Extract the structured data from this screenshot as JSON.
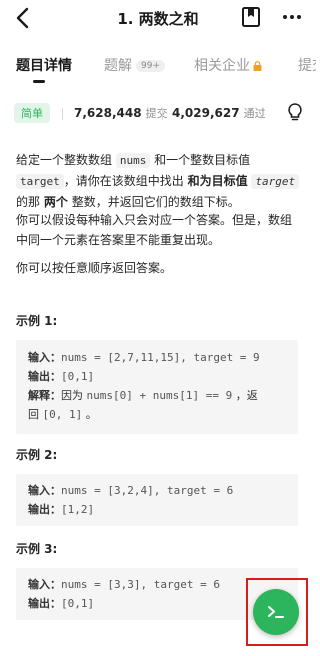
{
  "header": {
    "title": "1. 两数之和"
  },
  "tabs": [
    {
      "label": "题目详情"
    },
    {
      "label": "题解",
      "badge": "99+"
    },
    {
      "label": "相关企业"
    },
    {
      "label": "提交"
    }
  ],
  "stats": {
    "difficulty": "简单",
    "submissions_value": "7,628,448",
    "submissions_label": "提交",
    "accepted_value": "4,029,627",
    "accepted_label": "通过"
  },
  "description": {
    "p1_a": "给定一个整数数组 ",
    "p1_nums": "nums",
    "p1_b": " 和一个整数目标值",
    "p1_target": "target",
    "p1_c": "，请你在该数组中找出",
    "p1_d": "和为目标值",
    "p1_target2": "target",
    "p1_e": "的那",
    "p1_f": "两个",
    "p1_g": "整数，并返回它们的数组下标。",
    "p2": "你可以假设每种输入只会对应一个答案。但是，数组中同一个元素在答案里不能重复出现。",
    "p3": "你可以按任意顺序返回答案。"
  },
  "examples": [
    {
      "title": "示例 1:",
      "input_label": "输入：",
      "input_value": "nums = [2,7,11,15], target = 9",
      "output_label": "输出：",
      "output_value": "[0,1]",
      "explain_label": "解释：",
      "explain_value_a": "因为 ",
      "explain_value_code": "nums[0] + nums[1] == 9",
      "explain_value_b": " ，返",
      "explain_value_c": "回 ",
      "explain_value_code2": "[0, 1]",
      "explain_value_d": " 。"
    },
    {
      "title": "示例 2:",
      "input_label": "输入：",
      "input_value": "nums = [3,2,4], target = 6",
      "output_label": "输出：",
      "output_value": "[1,2]"
    },
    {
      "title": "示例 3:",
      "input_label": "输入：",
      "input_value": "nums = [3,3], target = 6",
      "output_label": "输出：",
      "output_value": "[0,1]"
    }
  ],
  "colors": {
    "accent_green": "#2db55d",
    "easy_bg": "#e3f5e8",
    "highlight_red": "#d41e1e"
  },
  "icons": [
    "back-arrow-icon",
    "bookmark-icon",
    "more-icon",
    "lock-icon",
    "lightbulb-icon",
    "terminal-icon"
  ]
}
